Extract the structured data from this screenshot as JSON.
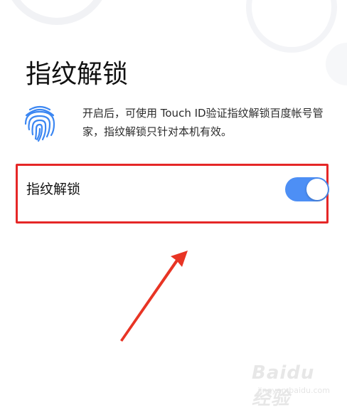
{
  "page": {
    "title": "指纹解锁",
    "description": "开启后，可使用 Touch ID验证指纹解锁百度帐号管家，指纹解锁只针对本机有效。"
  },
  "setting": {
    "label": "指纹解锁",
    "enabled": true
  },
  "icons": {
    "fingerprint": "fingerprint-icon",
    "arrow": "red-annotation-arrow"
  },
  "watermark": {
    "logo": "Baidu经验",
    "sub": "jingyan.baidu.com"
  },
  "colors": {
    "accent": "#4d8ff5",
    "highlight": "#e52727",
    "icon": "#3c87f2"
  }
}
